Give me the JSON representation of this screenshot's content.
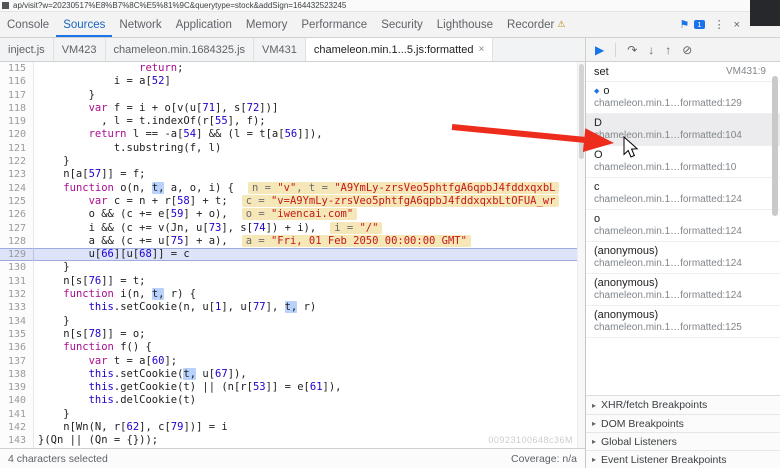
{
  "url_bar": {
    "text": "ap/visit?w=20230517%E8%B7%8C%E5%81%9C&querytype=stock&addSign=164432523245"
  },
  "icons": {
    "flag": "⚑",
    "menu": "⋮",
    "close": "×",
    "warn": "⚠",
    "section_arrow": "▸",
    "frame_marker": "◆",
    "tab_close": "×"
  },
  "panel_tabs": {
    "active": "Sources",
    "flag_badge": "1",
    "tabs": [
      {
        "label": "Console"
      },
      {
        "label": "Sources"
      },
      {
        "label": "Network"
      },
      {
        "label": "Application"
      },
      {
        "label": "Memory"
      },
      {
        "label": "Performance"
      },
      {
        "label": "Security"
      },
      {
        "label": "Lighthouse"
      },
      {
        "label": "Recorder",
        "warn": true
      }
    ]
  },
  "file_tabs": [
    {
      "label": "inject.js"
    },
    {
      "label": "VM423"
    },
    {
      "label": "chameleon.min.1684325.js"
    },
    {
      "label": "VM431"
    },
    {
      "label": "chameleon.min.1...5.js:formatted",
      "active": true,
      "closable": true
    }
  ],
  "debug_toolbar": {
    "icons": [
      {
        "name": "resume-script-button",
        "glyph": "▶",
        "primary": true
      },
      {
        "name": "step-over-button",
        "glyph": "↷"
      },
      {
        "name": "step-into-button",
        "glyph": "↓"
      },
      {
        "name": "step-out-button",
        "glyph": "↑"
      },
      {
        "name": "deactivate-breakpoints-button",
        "glyph": "⊘"
      }
    ]
  },
  "editor": {
    "lines": [
      {
        "num": 115,
        "tokens": [
          [
            "pl",
            "                "
          ],
          [
            "kw",
            "return"
          ],
          [
            "pl",
            ";"
          ]
        ]
      },
      {
        "num": 116,
        "tokens": [
          [
            "pl",
            "            i = a["
          ],
          [
            "num",
            "52"
          ],
          [
            "pl",
            "]"
          ]
        ]
      },
      {
        "num": 117,
        "tokens": [
          [
            "pl",
            "        }"
          ]
        ]
      },
      {
        "num": 118,
        "tokens": [
          [
            "pl",
            "        "
          ],
          [
            "kw",
            "var"
          ],
          [
            "pl",
            " f = i + o[v(u["
          ],
          [
            "num",
            "71"
          ],
          [
            "pl",
            "], s["
          ],
          [
            "num",
            "72"
          ],
          [
            "pl",
            "])]"
          ]
        ]
      },
      {
        "num": 119,
        "tokens": [
          [
            "pl",
            "          , l = t.indexOf(r["
          ],
          [
            "num",
            "55"
          ],
          [
            "pl",
            "], f);"
          ]
        ]
      },
      {
        "num": 120,
        "tokens": [
          [
            "pl",
            "        "
          ],
          [
            "kw",
            "return"
          ],
          [
            "pl",
            " l == -a["
          ],
          [
            "num",
            "54"
          ],
          [
            "pl",
            "] && (l = t[a["
          ],
          [
            "num",
            "56"
          ],
          [
            "pl",
            "]]),"
          ]
        ]
      },
      {
        "num": 121,
        "tokens": [
          [
            "pl",
            "            t.substring(f, l)"
          ]
        ]
      },
      {
        "num": 122,
        "tokens": [
          [
            "pl",
            "    }"
          ]
        ]
      },
      {
        "num": 123,
        "tokens": [
          [
            "pl",
            "    n[a["
          ],
          [
            "num",
            "57"
          ],
          [
            "pl",
            "]] = f;"
          ]
        ]
      },
      {
        "num": 124,
        "tokens": [
          [
            "pl",
            "    "
          ],
          [
            "kw",
            "function"
          ],
          [
            "pl",
            " o(n, "
          ],
          [
            "sel",
            "t,"
          ],
          [
            "pl",
            " a, o, i) {"
          ]
        ],
        "hint": [
          [
            "hn",
            "n = "
          ],
          [
            "hs",
            "\"v\""
          ],
          [
            "hn",
            ", t = "
          ],
          [
            "hs",
            "\"A9YmLy-zrsVeo5phtfgA6qpbJ4fddxqxbL"
          ]
        ]
      },
      {
        "num": 125,
        "tokens": [
          [
            "pl",
            "        "
          ],
          [
            "kw",
            "var"
          ],
          [
            "pl",
            " c = n + r["
          ],
          [
            "num",
            "58"
          ],
          [
            "pl",
            "] + t;"
          ]
        ],
        "hint": [
          [
            "hn",
            "c = "
          ],
          [
            "hs",
            "\"v=A9YmLy-zrsVeo5phtfgA6qpbJ4fddxqxbLtOFUA_wr"
          ]
        ]
      },
      {
        "num": 126,
        "tokens": [
          [
            "pl",
            "        o && (c += e["
          ],
          [
            "num",
            "59"
          ],
          [
            "pl",
            "] + o),"
          ]
        ],
        "hint": [
          [
            "hn",
            "o = "
          ],
          [
            "hs",
            "\"iwencai.com\""
          ]
        ]
      },
      {
        "num": 127,
        "tokens": [
          [
            "pl",
            "        i && (c += v(Jn, u["
          ],
          [
            "num",
            "73"
          ],
          [
            "pl",
            "], s["
          ],
          [
            "num",
            "74"
          ],
          [
            "pl",
            "]) + i),"
          ]
        ],
        "hint": [
          [
            "hn",
            "i = "
          ],
          [
            "hs",
            "\"/\""
          ]
        ]
      },
      {
        "num": 128,
        "tokens": [
          [
            "pl",
            "        a && (c += u["
          ],
          [
            "num",
            "75"
          ],
          [
            "pl",
            "] + a),"
          ]
        ],
        "hint": [
          [
            "hn",
            "a = "
          ],
          [
            "hs",
            "\"Fri, 01 Feb 2050 00:00:00 GMT\""
          ]
        ]
      },
      {
        "num": 129,
        "exec": true,
        "tokens": [
          [
            "pl",
            "        u["
          ],
          [
            "num",
            "66"
          ],
          [
            "pl",
            "][u["
          ],
          [
            "num",
            "68"
          ],
          [
            "pl",
            "]] = c"
          ]
        ]
      },
      {
        "num": 130,
        "tokens": [
          [
            "pl",
            "    }"
          ]
        ]
      },
      {
        "num": 131,
        "tokens": [
          [
            "pl",
            "    n[s["
          ],
          [
            "num",
            "76"
          ],
          [
            "pl",
            "]] = t;"
          ]
        ]
      },
      {
        "num": 132,
        "tokens": [
          [
            "pl",
            "    "
          ],
          [
            "kw",
            "function"
          ],
          [
            "pl",
            " i(n, "
          ],
          [
            "sel",
            "t,"
          ],
          [
            "pl",
            " r) {"
          ]
        ]
      },
      {
        "num": 133,
        "tokens": [
          [
            "pl",
            "        "
          ],
          [
            "atom",
            "this"
          ],
          [
            "pl",
            ".setCookie(n, u["
          ],
          [
            "num",
            "1"
          ],
          [
            "pl",
            "], u["
          ],
          [
            "num",
            "77"
          ],
          [
            "pl",
            "], "
          ],
          [
            "sel",
            "t,"
          ],
          [
            "pl",
            " r)"
          ]
        ]
      },
      {
        "num": 134,
        "tokens": [
          [
            "pl",
            "    }"
          ]
        ]
      },
      {
        "num": 135,
        "tokens": [
          [
            "pl",
            "    n[s["
          ],
          [
            "num",
            "78"
          ],
          [
            "pl",
            "]] = o;"
          ]
        ]
      },
      {
        "num": 136,
        "tokens": [
          [
            "pl",
            "    "
          ],
          [
            "kw",
            "function"
          ],
          [
            "pl",
            " f() {"
          ]
        ]
      },
      {
        "num": 137,
        "tokens": [
          [
            "pl",
            "        "
          ],
          [
            "kw",
            "var"
          ],
          [
            "pl",
            " t = a["
          ],
          [
            "num",
            "60"
          ],
          [
            "pl",
            "];"
          ]
        ]
      },
      {
        "num": 138,
        "tokens": [
          [
            "pl",
            "        "
          ],
          [
            "atom",
            "this"
          ],
          [
            "pl",
            ".setCookie("
          ],
          [
            "sel",
            "t,"
          ],
          [
            "pl",
            " u["
          ],
          [
            "num",
            "67"
          ],
          [
            "pl",
            "]),"
          ]
        ]
      },
      {
        "num": 139,
        "tokens": [
          [
            "pl",
            "        "
          ],
          [
            "atom",
            "this"
          ],
          [
            "pl",
            ".getCookie(t) || (n[r["
          ],
          [
            "num",
            "53"
          ],
          [
            "pl",
            "]] = e["
          ],
          [
            "num",
            "61"
          ],
          [
            "pl",
            "]),"
          ]
        ]
      },
      {
        "num": 140,
        "tokens": [
          [
            "pl",
            "        "
          ],
          [
            "atom",
            "this"
          ],
          [
            "pl",
            ".delCookie(t)"
          ]
        ]
      },
      {
        "num": 141,
        "tokens": [
          [
            "pl",
            "    }"
          ]
        ]
      },
      {
        "num": 142,
        "tokens": [
          [
            "pl",
            "    n[Wn(N, r["
          ],
          [
            "num",
            "62"
          ],
          [
            "pl",
            "], c["
          ],
          [
            "num",
            "79"
          ],
          [
            "pl",
            "])] = i"
          ]
        ]
      },
      {
        "num": 143,
        "tokens": [
          [
            "pl",
            "}(Qn || (Qn = {}));"
          ]
        ]
      }
    ]
  },
  "sidebar": {
    "frames": [
      {
        "name": "set",
        "loc": "VM431:9",
        "single": true
      },
      {
        "name": "o",
        "loc": "chameleon.min.1…formatted:129",
        "marker": true
      },
      {
        "name": "D",
        "loc": "chameleon.min.1…formatted:104",
        "hover": true
      },
      {
        "name": "O",
        "loc": "chameleon.min.1…formatted:10"
      },
      {
        "name": "c",
        "loc": "chameleon.min.1…formatted:124"
      },
      {
        "name": "o",
        "loc": "chameleon.min.1…formatted:124"
      },
      {
        "name": "(anonymous)",
        "loc": "chameleon.min.1…formatted:124"
      },
      {
        "name": "(anonymous)",
        "loc": "chameleon.min.1…formatted:124"
      },
      {
        "name": "(anonymous)",
        "loc": "chameleon.min.1…formatted:125"
      }
    ],
    "sections": [
      "XHR/fetch Breakpoints",
      "DOM Breakpoints",
      "Global Listeners",
      "Event Listener Breakpoints"
    ]
  },
  "status_bar": {
    "left": "4 characters selected",
    "coverage": "Coverage: n/a"
  },
  "watermark": "00923100648c36M"
}
